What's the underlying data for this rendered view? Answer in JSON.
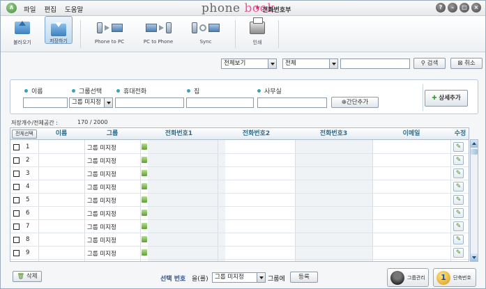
{
  "titlebar": {
    "menu": [
      "파일",
      "편집",
      "도움말"
    ],
    "brand_main": "phone",
    "brand_accent": "book",
    "brand_sub": "전화번호부"
  },
  "toolbar": {
    "items": [
      {
        "label": "불러오기",
        "icon": "upload-box-icon"
      },
      {
        "label": "저장하기",
        "icon": "download-box-icon",
        "active": true
      },
      {
        "label": "Phone to PC",
        "icon": "phone-to-pc-icon"
      },
      {
        "label": "PC to Phone",
        "icon": "pc-to-phone-icon"
      },
      {
        "label": "Sync",
        "icon": "sync-icon"
      },
      {
        "label": "인쇄",
        "icon": "printer-icon"
      }
    ]
  },
  "search": {
    "view_select": "전체보기",
    "scope_select": "전체",
    "query": "",
    "search_label": "검색",
    "cancel_label": "취소"
  },
  "filter": {
    "labels": {
      "name": "이름",
      "group": "그룹선택",
      "mobile": "휴대전화",
      "home": "집",
      "office": "사무실"
    },
    "group_value": "그룹 미지정",
    "quick_add": "간단추가",
    "detail_add": "상세추가"
  },
  "info": {
    "label": "저장개수/전체공간 :",
    "value": "170 / 2000"
  },
  "table": {
    "select_all": "전체선택",
    "headers": [
      "이름",
      "그룹",
      "전화번호1",
      "전화번호2",
      "전화번호3",
      "이메일",
      "수정"
    ],
    "rows": [
      {
        "num": "1",
        "group": "그룹 미지정"
      },
      {
        "num": "2",
        "group": "그룹 미지정"
      },
      {
        "num": "3",
        "group": "그룹 미지정"
      },
      {
        "num": "4",
        "group": "그룹 미지정"
      },
      {
        "num": "5",
        "group": "그룹 미지정"
      },
      {
        "num": "6",
        "group": "그룹 미지정"
      },
      {
        "num": "7",
        "group": "그룹 미지정"
      },
      {
        "num": "8",
        "group": "그룹 미지정"
      },
      {
        "num": "9",
        "group": "그룹 미지정"
      }
    ]
  },
  "bottom": {
    "delete": "삭제",
    "selected_prefix": "선택 번호",
    "selected_mid": "을(를)",
    "group_value": "그룹 미지정",
    "group_suffix": "그룹에",
    "register": "등록",
    "group_manage": "그룹관리",
    "speed_dial": "단축번호"
  },
  "colors": {
    "header_text": "#2d6b8a",
    "brand_accent": "#e8559a"
  }
}
